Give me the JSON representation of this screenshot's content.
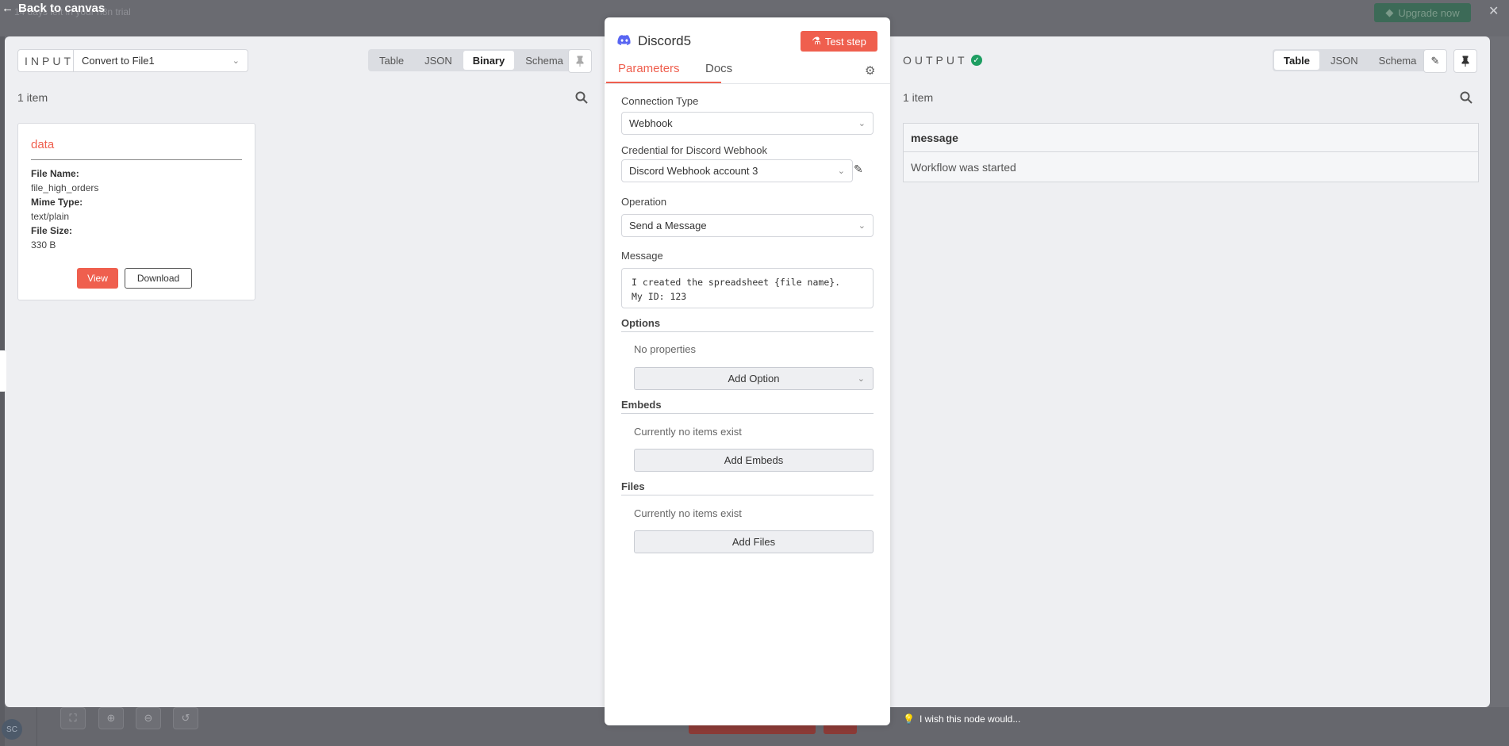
{
  "background": {
    "back_label": "Back to canvas",
    "trial_text": "14 days left in your n8n trial",
    "upgrade_label": "Upgrade now",
    "avatar_initials": "SC"
  },
  "input_panel": {
    "label": "INPUT",
    "source_node": "Convert to File1",
    "view_tabs": [
      "Table",
      "JSON",
      "Binary",
      "Schema"
    ],
    "active_tab": "Binary",
    "item_count": "1 item",
    "binary": {
      "key": "data",
      "file_name_label": "File Name:",
      "file_name": "file_high_orders",
      "mime_type_label": "Mime Type:",
      "mime_type": "text/plain",
      "file_size_label": "File Size:",
      "file_size": "330 B",
      "view_label": "View",
      "download_label": "Download"
    }
  },
  "node": {
    "title": "Discord5",
    "test_label": "Test step",
    "tabs": [
      "Parameters",
      "Docs"
    ],
    "active_tab": "Parameters",
    "connection_type_label": "Connection Type",
    "connection_type": "Webhook",
    "credential_label": "Credential for Discord Webhook",
    "credential": "Discord Webhook account 3",
    "operation_label": "Operation",
    "operation": "Send a Message",
    "message_label": "Message",
    "message": "I created the spreadsheet {file name}.\nMy ID: 123",
    "options_label": "Options",
    "options_empty": "No properties",
    "add_option_label": "Add Option",
    "embeds_label": "Embeds",
    "embeds_empty": "Currently no items exist",
    "add_embeds_label": "Add Embeds",
    "files_label": "Files",
    "files_empty": "Currently no items exist",
    "add_files_label": "Add Files"
  },
  "output_panel": {
    "label": "OUTPUT",
    "view_tabs": [
      "Table",
      "JSON",
      "Schema"
    ],
    "active_tab": "Table",
    "item_count": "1 item",
    "columns": [
      "message"
    ],
    "rows": [
      [
        "Workflow was started"
      ]
    ]
  },
  "footer": {
    "wish_text": "I wish this node would..."
  },
  "colors": {
    "accent": "#ef5f4e",
    "success": "#1e9e62",
    "panel_bg": "#eeeff2"
  }
}
